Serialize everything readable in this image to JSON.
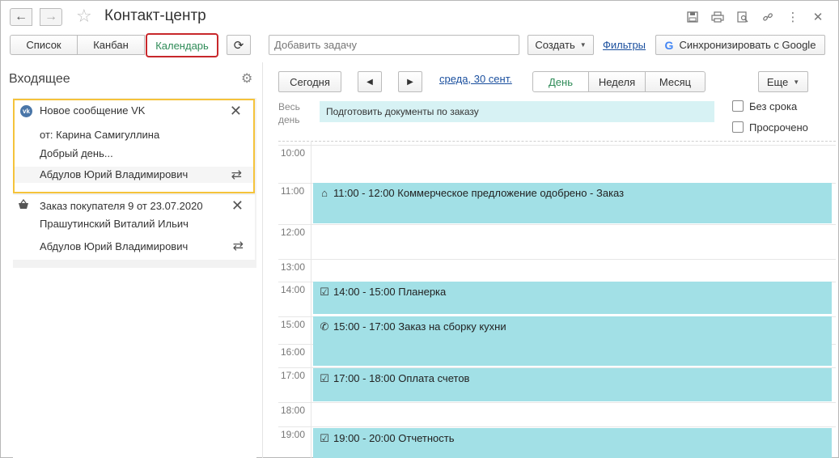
{
  "window": {
    "title": "Контакт-центр"
  },
  "toolbar": {
    "views": [
      {
        "label": "Список"
      },
      {
        "label": "Канбан"
      },
      {
        "label": "Календарь",
        "active": true
      }
    ],
    "add_task_placeholder": "Добавить задачу",
    "create_label": "Создать",
    "filters_label": "Фильтры",
    "sync_label": "Синхронизировать с Google"
  },
  "inbox": {
    "title": "Входящее",
    "items": [
      {
        "title": "Новое сообщение VK",
        "from": "от: Карина Самигуллина",
        "preview": "Добрый день...",
        "assignee": "Абдулов Юрий Владимирович",
        "icon": "vk-icon",
        "selected": true
      },
      {
        "title": "Заказ покупателя 9 от 23.07.2020",
        "from": "Прашутинский Виталий Ильич",
        "assignee": "Абдулов Юрий Владимирович",
        "icon": "basket-icon"
      }
    ]
  },
  "calendar": {
    "today_label": "Сегодня",
    "date_label": "среда, 30 сент.",
    "views": [
      {
        "label": "День",
        "active": true
      },
      {
        "label": "Неделя"
      },
      {
        "label": "Месяц"
      }
    ],
    "more_label": "Еще",
    "all_day_label": "Весь день",
    "all_day_events": [
      "Подготовить документы по заказу"
    ],
    "filters": [
      {
        "label": "Без срока",
        "checked": false
      },
      {
        "label": "Просрочено",
        "checked": false
      }
    ],
    "hours": [
      "10:00",
      "11:00",
      "12:00",
      "13:00",
      "14:00",
      "15:00",
      "16:00",
      "17:00",
      "18:00",
      "19:00"
    ],
    "events": [
      {
        "time": "11:00 - 12:00",
        "title": "Коммерческое предложение одобрено - Заказ",
        "icon": "home-icon"
      },
      {
        "time": "14:00 - 15:00",
        "title": "Планерка",
        "icon": "task-icon"
      },
      {
        "time": "15:00 - 17:00",
        "title": "Заказ на сборку кухни",
        "icon": "phone-icon"
      },
      {
        "time": "17:00 - 18:00",
        "title": "Оплата счетов",
        "icon": "task-icon"
      },
      {
        "time": "19:00 - 20:00",
        "title": "Отчетность",
        "icon": "task-icon"
      }
    ],
    "event_color": "#a2e0e6",
    "all_day_color": "#d7f2f4"
  },
  "colors": {
    "accent_green": "#2e8b57",
    "highlight_red": "#c8272b",
    "selected_border": "#f5c33b",
    "link_blue": "#1a4f9e"
  }
}
